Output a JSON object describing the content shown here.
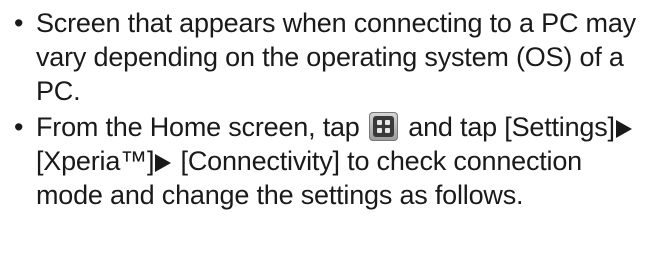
{
  "notes": [
    {
      "text": "Screen that appears when connecting to a PC may vary depending on the operating system (OS) of a PC."
    },
    {
      "part1": "From the Home screen, tap",
      "icon": "apps-grid-icon",
      "part2": "and tap",
      "step1": "[Settings]",
      "step2": "[Xperia™]",
      "step3": " [Connectivity]",
      "part3": "to check connection mode and change the settings as follows."
    }
  ],
  "bullet_char": "•"
}
